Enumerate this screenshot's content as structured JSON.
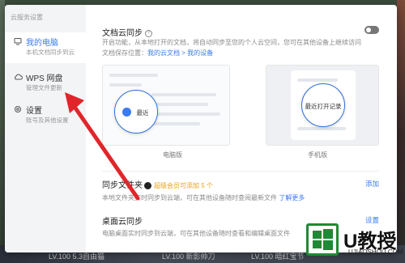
{
  "sidebar": {
    "title": "云服务设置",
    "items": [
      {
        "label": "我的电脑",
        "sub": "本机文档同步到云"
      },
      {
        "label": "WPS 网盘",
        "sub": "管理文件更新"
      },
      {
        "label": "设置",
        "sub": "账号及其他设置"
      }
    ]
  },
  "sync": {
    "title": "文档云同步",
    "desc1": "开启功能，从本地打开的文档，将自动同步至您的个人云空间，您可在其他设备上继续访问",
    "desc2_prefix": "文档保存位置：",
    "link": "我的云文档 > 我的设备",
    "pc_recent": "最近",
    "phone_recent": "最近打开记录",
    "pc_caption": "电脑版",
    "phone_caption": "手机版"
  },
  "folder": {
    "title": "同步文件夹",
    "vip": "超级会员可添加 5 个",
    "action": "添加",
    "desc": "本地文件夹实时同步到云端，可在其他设备随时查阅最新文件",
    "more": "了解更多"
  },
  "desktop": {
    "title": "桌面云同步",
    "action": "设置",
    "desc": "电脑桌面实时同步到云端，可在其他设备随时查看和编辑桌面文件"
  },
  "footer": {
    "t1": "LV.100 5.3自由猫",
    "t2": "LV.100 新影帅刀",
    "t3": "LV.100 暗红宝节"
  },
  "watermark": {
    "brand": "U教授",
    "url": "UJIAOSHOU.COM"
  },
  "colors": {
    "accent": "#3a7bf0",
    "vip": "#e8a316",
    "arrow": "#e0262b"
  }
}
